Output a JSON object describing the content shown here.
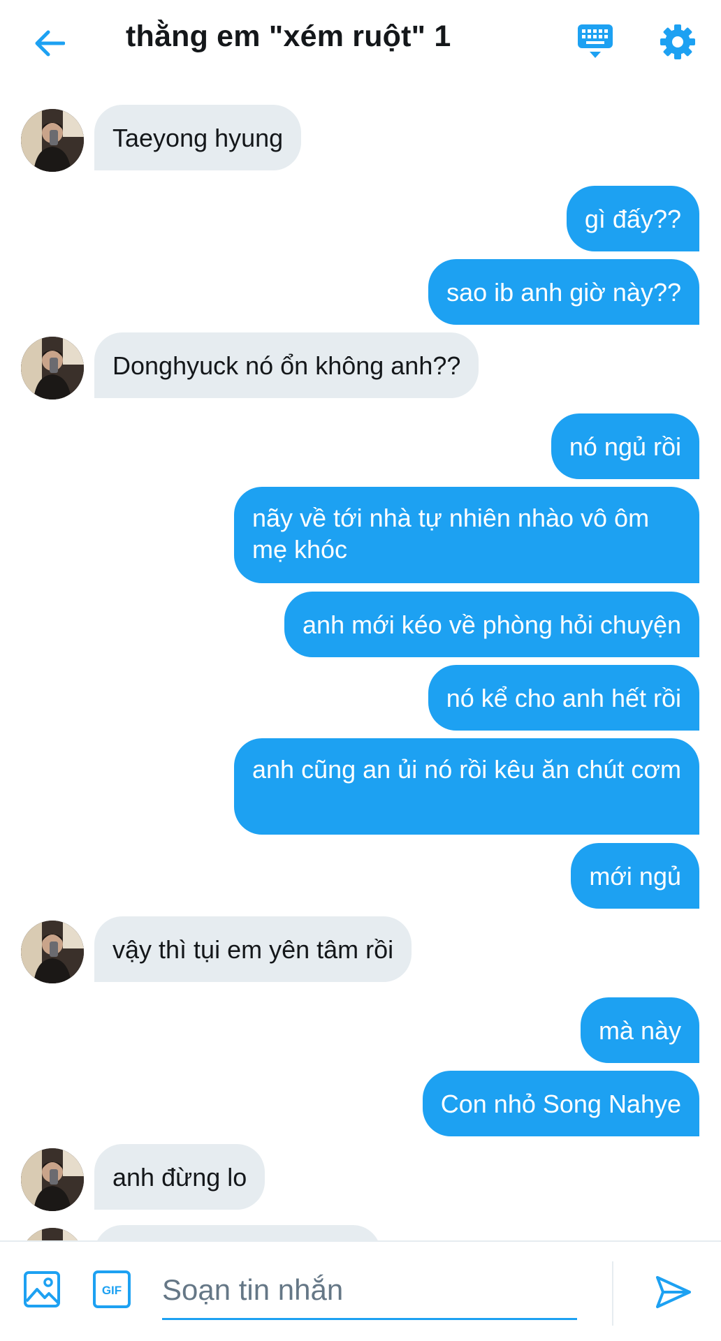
{
  "header": {
    "title": "thằng em \"xém ruột\" 1",
    "back_icon": "arrow-left-icon",
    "keyboard_icon": "keyboard-icon",
    "settings_icon": "gear-icon"
  },
  "messages": [
    {
      "dir": "in",
      "text": "Taeyong hyung"
    },
    {
      "dir": "out",
      "text": "gì đấy??"
    },
    {
      "dir": "out",
      "text": "sao ib anh giờ này??"
    },
    {
      "dir": "in",
      "text": "Donghyuck nó ổn không anh??"
    },
    {
      "dir": "out",
      "text": "nó ngủ rồi"
    },
    {
      "dir": "out",
      "text": "nãy về tới nhà tự nhiên nhào vô ôm mẹ khóc"
    },
    {
      "dir": "out",
      "text": "anh mới kéo về phòng hỏi chuyện"
    },
    {
      "dir": "out",
      "text": "nó kể cho anh hết rồi"
    },
    {
      "dir": "out",
      "text": "anh cũng an ủi nó rồi kêu ăn chút cơm"
    },
    {
      "dir": "out",
      "text": "mới ngủ"
    },
    {
      "dir": "in",
      "text": "vậy thì tụi em yên tâm rồi"
    },
    {
      "dir": "out",
      "text": "mà này"
    },
    {
      "dir": "out",
      "text": "Con nhỏ Song Nahye"
    },
    {
      "dir": "in",
      "text": "anh đừng lo"
    },
    {
      "dir": "in",
      "text": ""
    }
  ],
  "composer": {
    "placeholder": "Soạn tin nhắn",
    "value": "",
    "gif_label": "GIF",
    "media_icon": "image-icon",
    "send_icon": "send-icon"
  },
  "colors": {
    "accent": "#1da1f2",
    "incoming_bubble": "#e6ecf0",
    "text": "#14171a",
    "placeholder": "#657786"
  }
}
